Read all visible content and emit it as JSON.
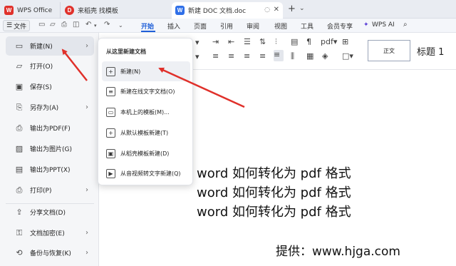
{
  "tabs": [
    {
      "name": "WPS Office",
      "icon": "wps-logo-icon"
    },
    {
      "name": "来稻壳 找模板",
      "icon": "daoke-logo-icon"
    },
    {
      "name": "新建 DOC 文档.doc",
      "icon": "word-doc-icon"
    }
  ],
  "menubar": {
    "file_label": "文件",
    "items": [
      "开始",
      "插入",
      "页面",
      "引用",
      "审阅",
      "视图",
      "工具",
      "会员专享",
      "WPS AI"
    ],
    "active": "开始"
  },
  "file_menu": {
    "items": [
      {
        "label": "新建(N)",
        "icon": "new-doc-icon",
        "submenu": true,
        "highlighted": true
      },
      {
        "label": "打开(O)",
        "icon": "folder-open-icon",
        "submenu": false
      },
      {
        "label": "保存(S)",
        "icon": "save-icon",
        "submenu": false
      },
      {
        "label": "另存为(A)",
        "icon": "save-as-icon",
        "submenu": true
      },
      {
        "label": "输出为PDF(F)",
        "icon": "pdf-icon",
        "submenu": false
      },
      {
        "label": "输出为图片(G)",
        "icon": "image-icon",
        "submenu": false
      },
      {
        "label": "输出为PPT(X)",
        "icon": "ppt-icon",
        "submenu": false
      },
      {
        "label": "打印(P)",
        "icon": "print-icon",
        "submenu": true
      },
      {
        "label": "分享文档(D)",
        "icon": "share-icon",
        "submenu": false
      },
      {
        "label": "文档加密(E)",
        "icon": "lock-icon",
        "submenu": true
      },
      {
        "label": "备份与恢复(K)",
        "icon": "backup-icon",
        "submenu": true
      }
    ]
  },
  "new_popup": {
    "title": "从这里新建文档",
    "items": [
      {
        "label": "新建(N)",
        "icon": "plus-doc-icon",
        "highlighted": true
      },
      {
        "label": "新建在线文字文档(O)",
        "icon": "online-doc-icon"
      },
      {
        "label": "本机上的模板(M)...",
        "icon": "template-icon"
      },
      {
        "label": "从默认模板新建(T)",
        "icon": "default-template-icon"
      },
      {
        "label": "从稻壳模板新建(D)",
        "icon": "daoke-template-icon"
      },
      {
        "label": "从音视频转文字新建(Q)",
        "icon": "av-transcribe-icon"
      }
    ]
  },
  "styles": {
    "normal": "正文",
    "heading1": "标题 1"
  },
  "document": {
    "lines": [
      "word 如何转化为 pdf 格式",
      "word 如何转化为 pdf 格式",
      "word 如何转化为 pdf 格式"
    ],
    "credit": "提供：www.hjga.com"
  },
  "colors": {
    "accent": "#1f5fd8",
    "arrow": "#e0302a",
    "wps_red": "#e0312b",
    "doc_blue": "#2f6fe8"
  }
}
